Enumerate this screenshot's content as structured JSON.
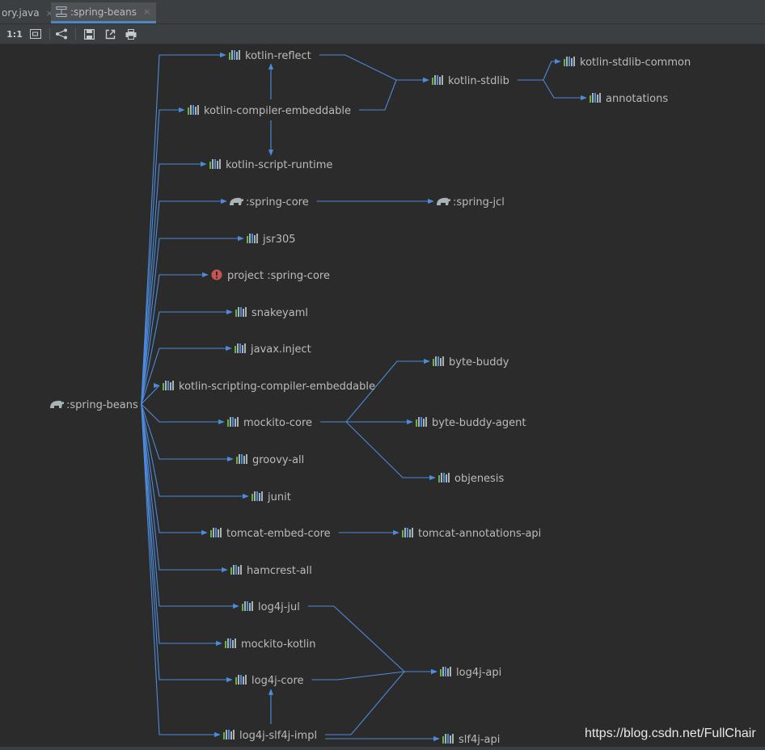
{
  "tabs": [
    {
      "label": "ory.java",
      "close": "×"
    },
    {
      "label": ":spring-beans",
      "close": "×"
    }
  ],
  "toolbar": {
    "actual_size_label": "1:1"
  },
  "colors": {
    "background": "#2b2b2b",
    "edge": "#4d8bdb",
    "label": "#bbbbbb",
    "error": "#c75450",
    "gradle": "#a9b2b6"
  },
  "graph": {
    "nodes": [
      {
        "id": "root",
        "label": ":spring-beans",
        "icon": "gradle-elephant-icon"
      },
      {
        "id": "kr",
        "label": "kotlin-reflect",
        "icon": "library-icon"
      },
      {
        "id": "kce",
        "label": "kotlin-compiler-embeddable",
        "icon": "library-icon"
      },
      {
        "id": "ksr",
        "label": "kotlin-script-runtime",
        "icon": "library-icon"
      },
      {
        "id": "sc",
        "label": ":spring-core",
        "icon": "gradle-elephant-icon"
      },
      {
        "id": "jsr",
        "label": "jsr305",
        "icon": "library-icon"
      },
      {
        "id": "psc",
        "label": "project :spring-core",
        "icon": "error-icon"
      },
      {
        "id": "sy",
        "label": "snakeyaml",
        "icon": "library-icon"
      },
      {
        "id": "ji",
        "label": "javax.inject",
        "icon": "library-icon"
      },
      {
        "id": "ksce",
        "label": "kotlin-scripting-compiler-embeddable",
        "icon": "library-icon"
      },
      {
        "id": "mc",
        "label": "mockito-core",
        "icon": "library-icon"
      },
      {
        "id": "ga",
        "label": "groovy-all",
        "icon": "library-icon"
      },
      {
        "id": "ju",
        "label": "junit",
        "icon": "library-icon"
      },
      {
        "id": "tec",
        "label": "tomcat-embed-core",
        "icon": "library-icon"
      },
      {
        "id": "ha",
        "label": "hamcrest-all",
        "icon": "library-icon"
      },
      {
        "id": "l4jul",
        "label": "log4j-jul",
        "icon": "library-icon"
      },
      {
        "id": "mk",
        "label": "mockito-kotlin",
        "icon": "library-icon"
      },
      {
        "id": "l4core",
        "label": "log4j-core",
        "icon": "library-icon"
      },
      {
        "id": "l4slf",
        "label": "log4j-slf4j-impl",
        "icon": "library-icon"
      },
      {
        "id": "ksl",
        "label": "kotlin-stdlib",
        "icon": "library-icon"
      },
      {
        "id": "kslc",
        "label": "kotlin-stdlib-common",
        "icon": "library-icon"
      },
      {
        "id": "ann",
        "label": "annotations",
        "icon": "library-icon"
      },
      {
        "id": "jcl",
        "label": ":spring-jcl",
        "icon": "gradle-elephant-icon"
      },
      {
        "id": "bb",
        "label": "byte-buddy",
        "icon": "library-icon"
      },
      {
        "id": "bba",
        "label": "byte-buddy-agent",
        "icon": "library-icon"
      },
      {
        "id": "obj",
        "label": "objenesis",
        "icon": "library-icon"
      },
      {
        "id": "tca",
        "label": "tomcat-annotations-api",
        "icon": "library-icon"
      },
      {
        "id": "l4api",
        "label": "log4j-api",
        "icon": "library-icon"
      },
      {
        "id": "slf",
        "label": "slf4j-api",
        "icon": "library-icon"
      }
    ],
    "edges": [
      [
        "root",
        "kr"
      ],
      [
        "root",
        "kce"
      ],
      [
        "root",
        "ksr"
      ],
      [
        "root",
        "sc"
      ],
      [
        "root",
        "jsr"
      ],
      [
        "root",
        "psc"
      ],
      [
        "root",
        "sy"
      ],
      [
        "root",
        "ji"
      ],
      [
        "root",
        "ksce"
      ],
      [
        "root",
        "mc"
      ],
      [
        "root",
        "ga"
      ],
      [
        "root",
        "ju"
      ],
      [
        "root",
        "tec"
      ],
      [
        "root",
        "ha"
      ],
      [
        "root",
        "l4jul"
      ],
      [
        "root",
        "mk"
      ],
      [
        "root",
        "l4core"
      ],
      [
        "root",
        "l4slf"
      ],
      [
        "kce",
        "kr"
      ],
      [
        "kce",
        "ksr"
      ],
      [
        "kr",
        "ksl"
      ],
      [
        "kce",
        "ksl"
      ],
      [
        "ksl",
        "kslc"
      ],
      [
        "ksl",
        "ann"
      ],
      [
        "sc",
        "jcl"
      ],
      [
        "mc",
        "bb"
      ],
      [
        "mc",
        "bba"
      ],
      [
        "mc",
        "obj"
      ],
      [
        "tec",
        "tca"
      ],
      [
        "l4jul",
        "l4api"
      ],
      [
        "l4core",
        "l4api"
      ],
      [
        "l4slf",
        "l4api"
      ],
      [
        "l4slf",
        "l4core"
      ],
      [
        "l4slf",
        "slf"
      ]
    ]
  },
  "watermark": "https://blog.csdn.net/FullChair"
}
